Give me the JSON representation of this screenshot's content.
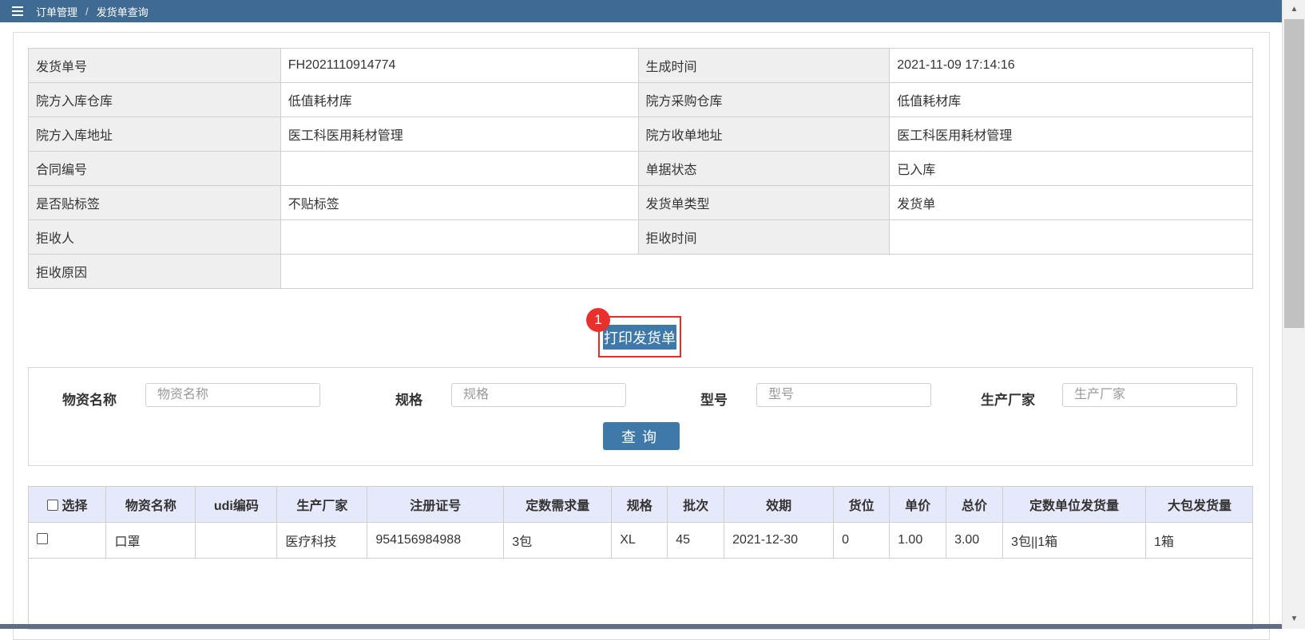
{
  "breadcrumb": {
    "parent": "订单管理",
    "separator": "/",
    "current": "发货单查询"
  },
  "info_rows": [
    {
      "k1": "发货单号",
      "v1": "FH2021110914774",
      "k2": "生成时间",
      "v2": "2021-11-09 17:14:16"
    },
    {
      "k1": "院方入库仓库",
      "v1": "低值耗材库",
      "k2": "院方采购仓库",
      "v2": "低值耗材库"
    },
    {
      "k1": "院方入库地址",
      "v1": "医工科医用耗材管理",
      "k2": "院方收单地址",
      "v2": "医工科医用耗材管理"
    },
    {
      "k1": "合同编号",
      "v1": "",
      "k2": "单据状态",
      "v2": "已入库"
    },
    {
      "k1": "是否贴标签",
      "v1": "不贴标签",
      "k2": "发货单类型",
      "v2": "发货单"
    },
    {
      "k1": "拒收人",
      "v1": "",
      "k2": "拒收时间",
      "v2": ""
    },
    {
      "k1": "拒收原因",
      "v1": ""
    }
  ],
  "print_button": {
    "label": "打印发货单",
    "marker": "1"
  },
  "search": {
    "material_label": "物资名称",
    "material_placeholder": "物资名称",
    "spec_label": "规格",
    "spec_placeholder": "规格",
    "model_label": "型号",
    "model_placeholder": "型号",
    "maker_label": "生产厂家",
    "maker_placeholder": "生产厂家",
    "query_label": "查询"
  },
  "grid": {
    "headers": [
      "选择",
      "物资名称",
      "udi编码",
      "生产厂家",
      "注册证号",
      "定数需求量",
      "规格",
      "批次",
      "效期",
      "货位",
      "单价",
      "总价",
      "定数单位发货量",
      "大包发货量"
    ],
    "rows": [
      [
        "",
        "口罩",
        "",
        "医疗科技",
        "954156984988",
        "3包",
        "XL",
        "45",
        "2021-12-30",
        "0",
        "1.00",
        "3.00",
        "3包||1箱",
        "1箱"
      ]
    ]
  },
  "colors": {
    "topbar": "#3f6a92",
    "primary_button": "#3f79aa",
    "highlight": "#e0302a",
    "grid_header": "#e6e9fa"
  }
}
